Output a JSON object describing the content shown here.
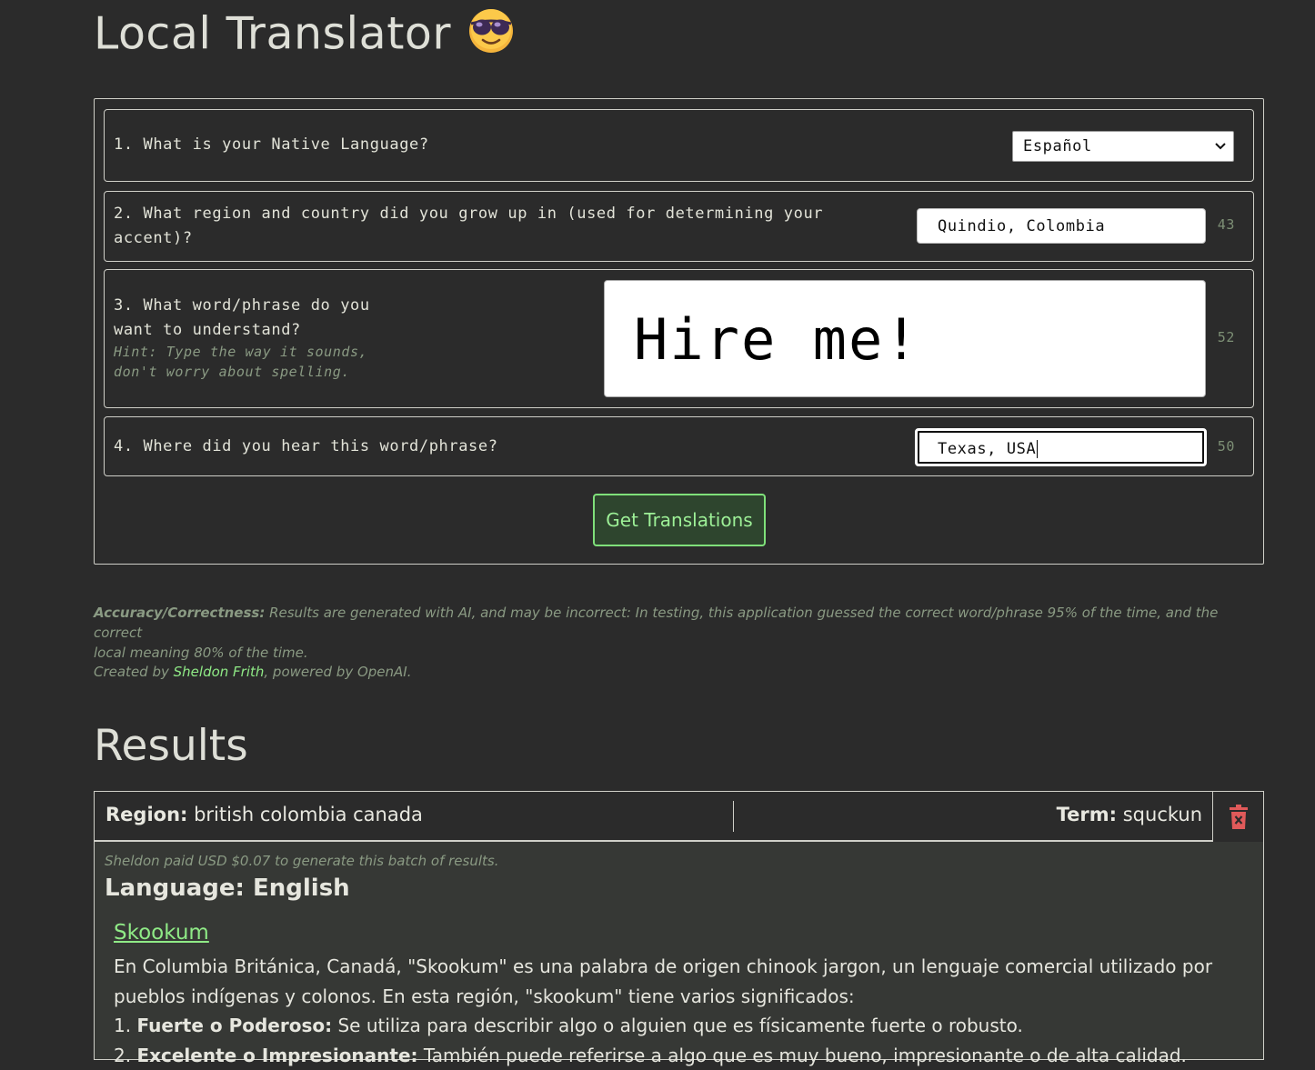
{
  "app": {
    "title": "Local Translator",
    "emoji_icon": "sunglasses-face-icon"
  },
  "form": {
    "q1": {
      "label": "1. What is your Native Language?",
      "selected": "Español"
    },
    "q2": {
      "label_line1": "2. What region and country did you grow up in (used for determining your",
      "label_line2": "accent)?",
      "value": "Quindio, Colombia",
      "count": "43"
    },
    "q3": {
      "label_line1": "3. What word/phrase do you",
      "label_line2": "want to understand?",
      "hint_line1": "Hint: Type the way it sounds,",
      "hint_line2": "don't worry about spelling.",
      "value": "Hire me!",
      "count": "52"
    },
    "q4": {
      "label": "4. Where did you hear this word/phrase?",
      "value": "Texas, USA",
      "count": "50"
    },
    "submit_label": "Get Translations"
  },
  "notes": {
    "accuracy_heading": "Accuracy/Correctness:",
    "accuracy_text_1": " Results are generated with AI, and may be incorrect: In testing, this application guessed the correct word/phrase 95% of the time, and the correct",
    "accuracy_text_2": "local meaning 80% of the time.",
    "created_prefix": "Created by ",
    "author": "Sheldon Frith",
    "created_suffix": ", powered by OpenAI."
  },
  "results": {
    "heading": "Results",
    "region_label": "Region:",
    "region_value": " british colombia canada",
    "term_label": "Term:",
    "term_value": " squckun",
    "paid_note": "Sheldon paid USD $0.07 to generate this batch of results.",
    "language_heading": "Language: English",
    "term_link": "Skookum",
    "desc_1": "En Columbia Británica, Canadá, \"Skookum\" es una palabra de origen chinook jargon, un lenguaje comercial utilizado por",
    "desc_2": "pueblos indígenas y colonos. En esta región, \"skookum\" tiene varios significados:",
    "item1_num": "1. ",
    "item1_bold": "Fuerte o Poderoso:",
    "item1_text": " Se utiliza para describir algo o alguien que es físicamente fuerte o robusto.",
    "item2_num": "2. ",
    "item2_bold": "Excelente o Impresionante:",
    "item2_text": " También puede referirse a algo que es muy bueno, impresionante o de alta calidad."
  },
  "colors": {
    "background": "#2b2b2b",
    "accent_green": "#8fea86",
    "button_bg": "#2e452e",
    "delete_red": "#e05a5a"
  }
}
